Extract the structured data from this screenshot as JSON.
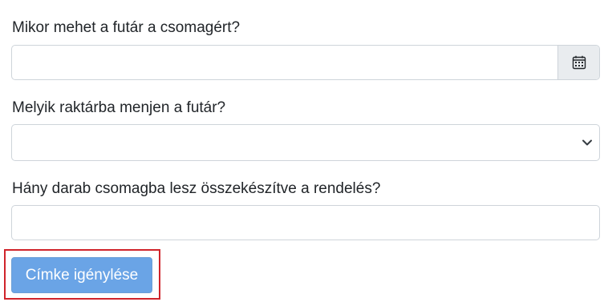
{
  "form": {
    "pickup_time": {
      "label": "Mikor mehet a futár a csomagért?",
      "value": "",
      "addon_icon": "calendar-icon"
    },
    "warehouse": {
      "label": "Melyik raktárba menjen a futár?",
      "selected": "",
      "dropdown_icon": "chevron-down-icon"
    },
    "package_count": {
      "label": "Hány darab csomagba lesz összekészítve a rendelés?",
      "value": ""
    },
    "submit_label": "Címke igénylése"
  },
  "colors": {
    "button": "#6aa4e6",
    "highlight": "#d0242b",
    "addon_bg": "#e9ecef",
    "border": "#ced4da"
  }
}
